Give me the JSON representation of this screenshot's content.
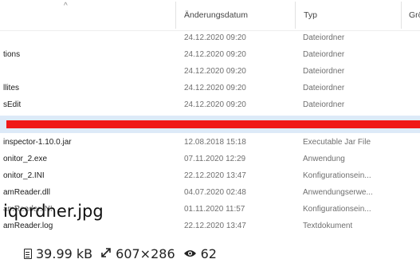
{
  "explorer": {
    "sort_caret": "^",
    "columns": {
      "date": "Änderungsdatum",
      "type": "Typ",
      "size": "Größ"
    },
    "rows": [
      {
        "name": "",
        "date": "24.12.2020 09:20",
        "type": "Dateiordner"
      },
      {
        "name": "tions",
        "date": "24.12.2020 09:20",
        "type": "Dateiordner"
      },
      {
        "name": "",
        "date": "24.12.2020 09:20",
        "type": "Dateiordner"
      },
      {
        "name": "llites",
        "date": "24.12.2020 09:20",
        "type": "Dateiordner"
      },
      {
        "name": "sEdit",
        "date": "24.12.2020 09:20",
        "type": "Dateiordner"
      }
    ],
    "rows2": [
      {
        "name": "inspector-1.10.0.jar",
        "date": "12.08.2018 15:18",
        "type": "Executable Jar File"
      },
      {
        "name": "onitor_2.exe",
        "date": "07.11.2020 12:29",
        "type": "Anwendung"
      },
      {
        "name": "onitor_2.INI",
        "date": "22.12.2020 13:47",
        "type": "Konfigurationsein..."
      },
      {
        "name": "amReader.dll",
        "date": "04.07.2020 02:48",
        "type": "Anwendungserwe..."
      },
      {
        "name": "amReader.INI",
        "date": "01.11.2020 11:57",
        "type": "Konfigurationsein..."
      },
      {
        "name": "amReader.log",
        "date": "22.12.2020 13:47",
        "type": "Textdokument"
      }
    ],
    "selected_row_color": "#ddeaf8",
    "redaction_color": "#f01818"
  },
  "overlay_title": "iqordner.jpg",
  "meta": {
    "file_size": "39.99 kB",
    "dimensions": "607×286",
    "views": "62"
  }
}
